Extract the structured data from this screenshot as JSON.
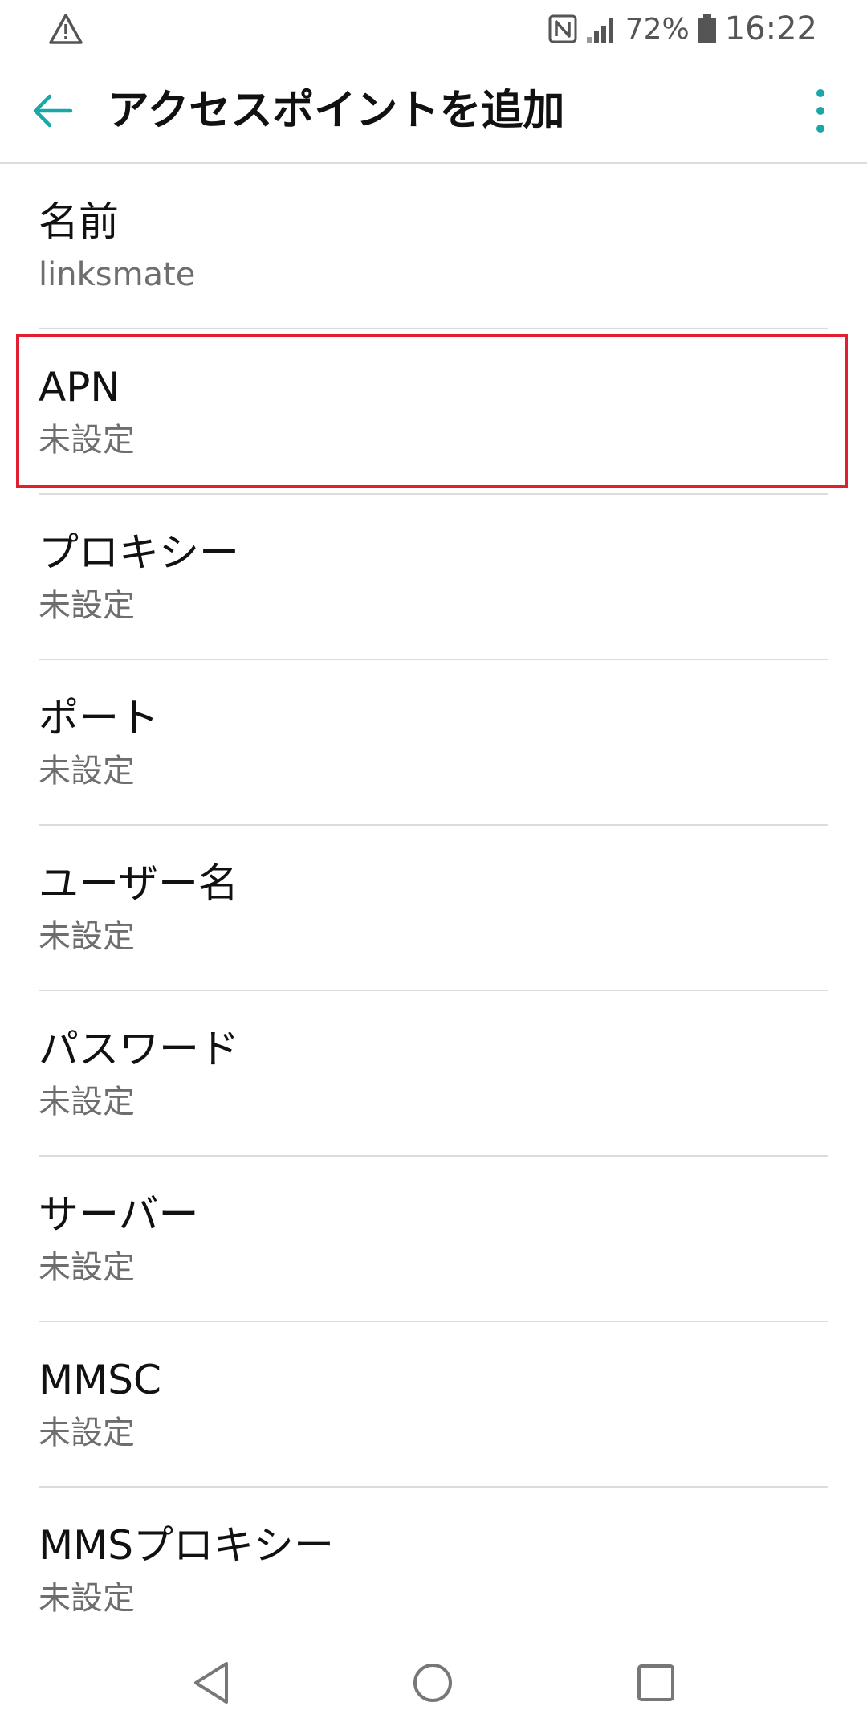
{
  "status_bar": {
    "warning_icon": "warning-triangle-icon",
    "nfc_icon": "nfc-icon",
    "signal_icon": "signal-icon",
    "battery_percent": "72%",
    "battery_icon": "battery-icon",
    "time": "16:22"
  },
  "app_bar": {
    "back_icon": "arrow-back-icon",
    "title": "アクセスポイントを追加",
    "overflow_icon": "more-vert-icon",
    "accent_color": "#19a8a8"
  },
  "settings": [
    {
      "title": "名前",
      "value": "linksmate"
    },
    {
      "title": "APN",
      "value": "未設定"
    },
    {
      "title": "プロキシー",
      "value": "未設定"
    },
    {
      "title": "ポート",
      "value": "未設定"
    },
    {
      "title": "ユーザー名",
      "value": "未設定"
    },
    {
      "title": "パスワード",
      "value": "未設定"
    },
    {
      "title": "サーバー",
      "value": "未設定"
    },
    {
      "title": "MMSC",
      "value": "未設定"
    },
    {
      "title": "MMSプロキシー",
      "value": "未設定"
    }
  ],
  "highlight": {
    "target": "APN",
    "color": "#e02030"
  },
  "nav_bar": {
    "back_icon": "nav-back-triangle-icon",
    "home_icon": "nav-home-circle-icon",
    "recent_icon": "nav-recents-square-icon"
  }
}
